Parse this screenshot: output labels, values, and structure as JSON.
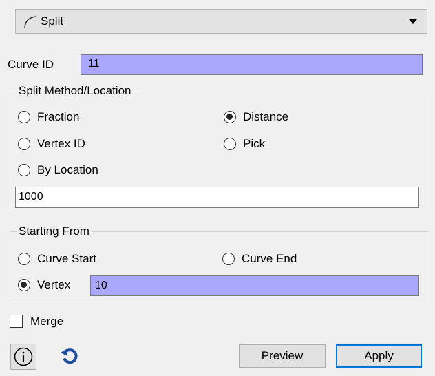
{
  "operation_select": {
    "selected": "Split",
    "icon": "curve-arc-icon"
  },
  "curve_id": {
    "label": "Curve ID",
    "value": "11"
  },
  "split_method": {
    "title": "Split Method/Location",
    "options": {
      "fraction": "Fraction",
      "distance": "Distance",
      "vertex_id": "Vertex ID",
      "pick": "Pick",
      "by_location": "By Location"
    },
    "selected": "Distance",
    "value": "1000"
  },
  "starting_from": {
    "title": "Starting From",
    "options": {
      "curve_start": "Curve Start",
      "curve_end": "Curve End",
      "vertex": "Vertex"
    },
    "selected": "Vertex",
    "vertex_value": "10"
  },
  "merge": {
    "label": "Merge",
    "checked": false
  },
  "buttons": {
    "preview": "Preview",
    "apply": "Apply"
  },
  "icons": {
    "info": "info-icon",
    "reset": "reset-icon"
  },
  "colors": {
    "highlight_input": "#a9a7ff",
    "apply_border": "#0078d7",
    "reset_icon": "#1e4fa3"
  }
}
